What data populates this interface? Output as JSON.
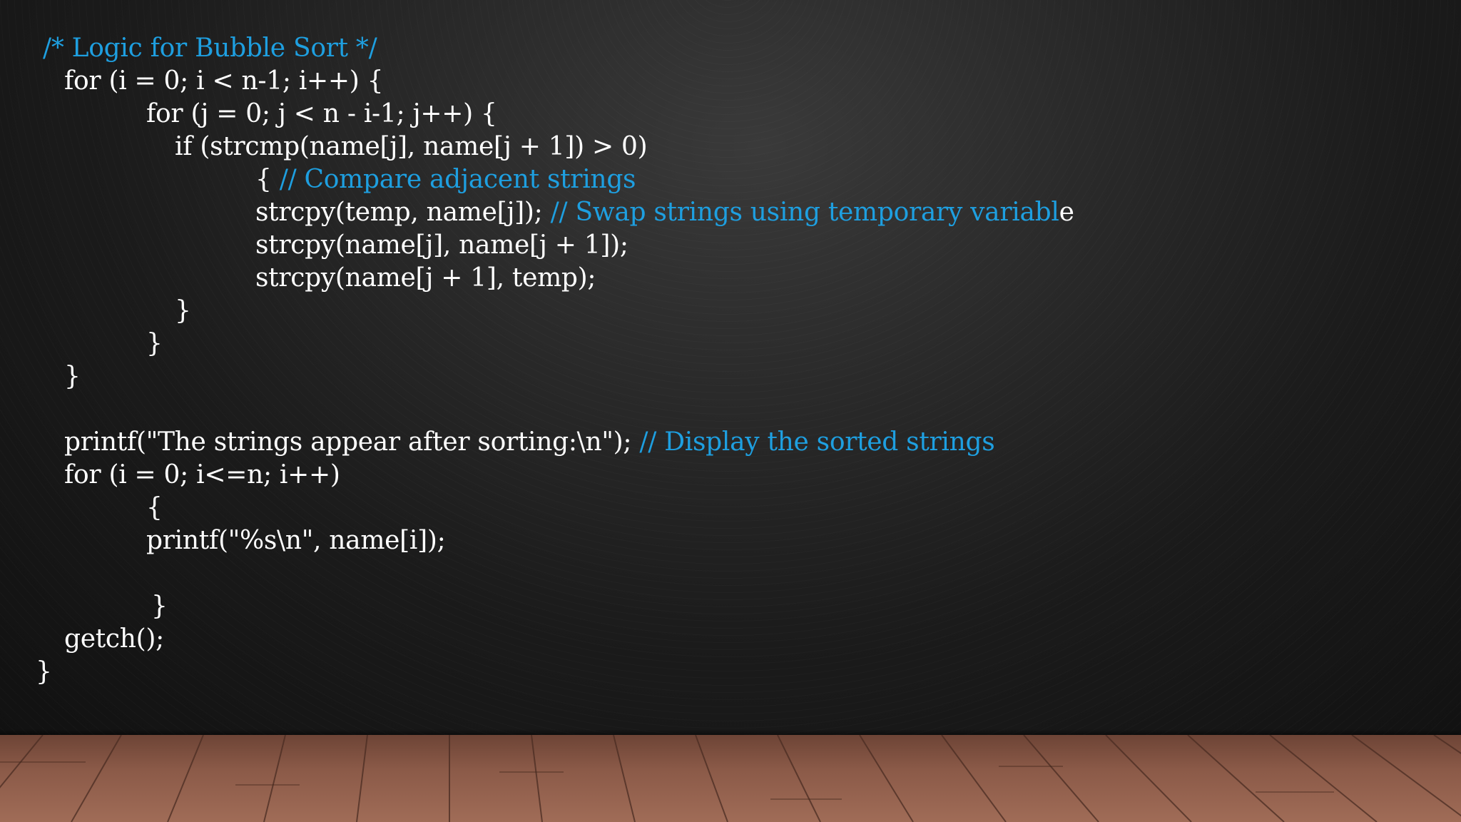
{
  "slide": {
    "colors": {
      "code_text": "#ffffff",
      "comment_text": "#1e9fe0",
      "background": "#1e1e1e",
      "floor": "#9a6652"
    },
    "lines": [
      {
        "code": "",
        "comment": "/* Logic for Bubble Sort */",
        "tail": ""
      },
      {
        "code": "for (i = 0; i < n-1; i++) {",
        "comment": "",
        "tail": ""
      },
      {
        "code": "for (j = 0; j < n - i-1; j++) {",
        "comment": "",
        "tail": ""
      },
      {
        "code": "if (strcmp(name[j], name[j + 1]) > 0)",
        "comment": "",
        "tail": ""
      },
      {
        "code": "{ ",
        "comment": "// Compare adjacent strings",
        "tail": ""
      },
      {
        "code": "strcpy(temp, name[j]); ",
        "comment": "// Swap strings using temporary variabl",
        "tail": "e"
      },
      {
        "code": "strcpy(name[j], name[j + 1]);",
        "comment": "",
        "tail": ""
      },
      {
        "code": "strcpy(name[j + 1], temp);",
        "comment": "",
        "tail": ""
      },
      {
        "code": "}",
        "comment": "",
        "tail": ""
      },
      {
        "code": "}",
        "comment": "",
        "tail": ""
      },
      {
        "code": "}",
        "comment": "",
        "tail": ""
      },
      {
        "code": "printf(\"The strings appear after sorting:\\n\"); ",
        "comment": "// Display the sorted strings",
        "tail": ""
      },
      {
        "code": "for (i = 0; i<=n; i++)",
        "comment": "",
        "tail": ""
      },
      {
        "code": "{",
        "comment": "",
        "tail": ""
      },
      {
        "code": "printf(\"%s\\n\", name[i]);",
        "comment": "",
        "tail": ""
      },
      {
        "code": "}",
        "comment": "",
        "tail": ""
      },
      {
        "code": "getch();",
        "comment": "",
        "tail": ""
      },
      {
        "code": "}",
        "comment": "",
        "tail": ""
      }
    ]
  }
}
